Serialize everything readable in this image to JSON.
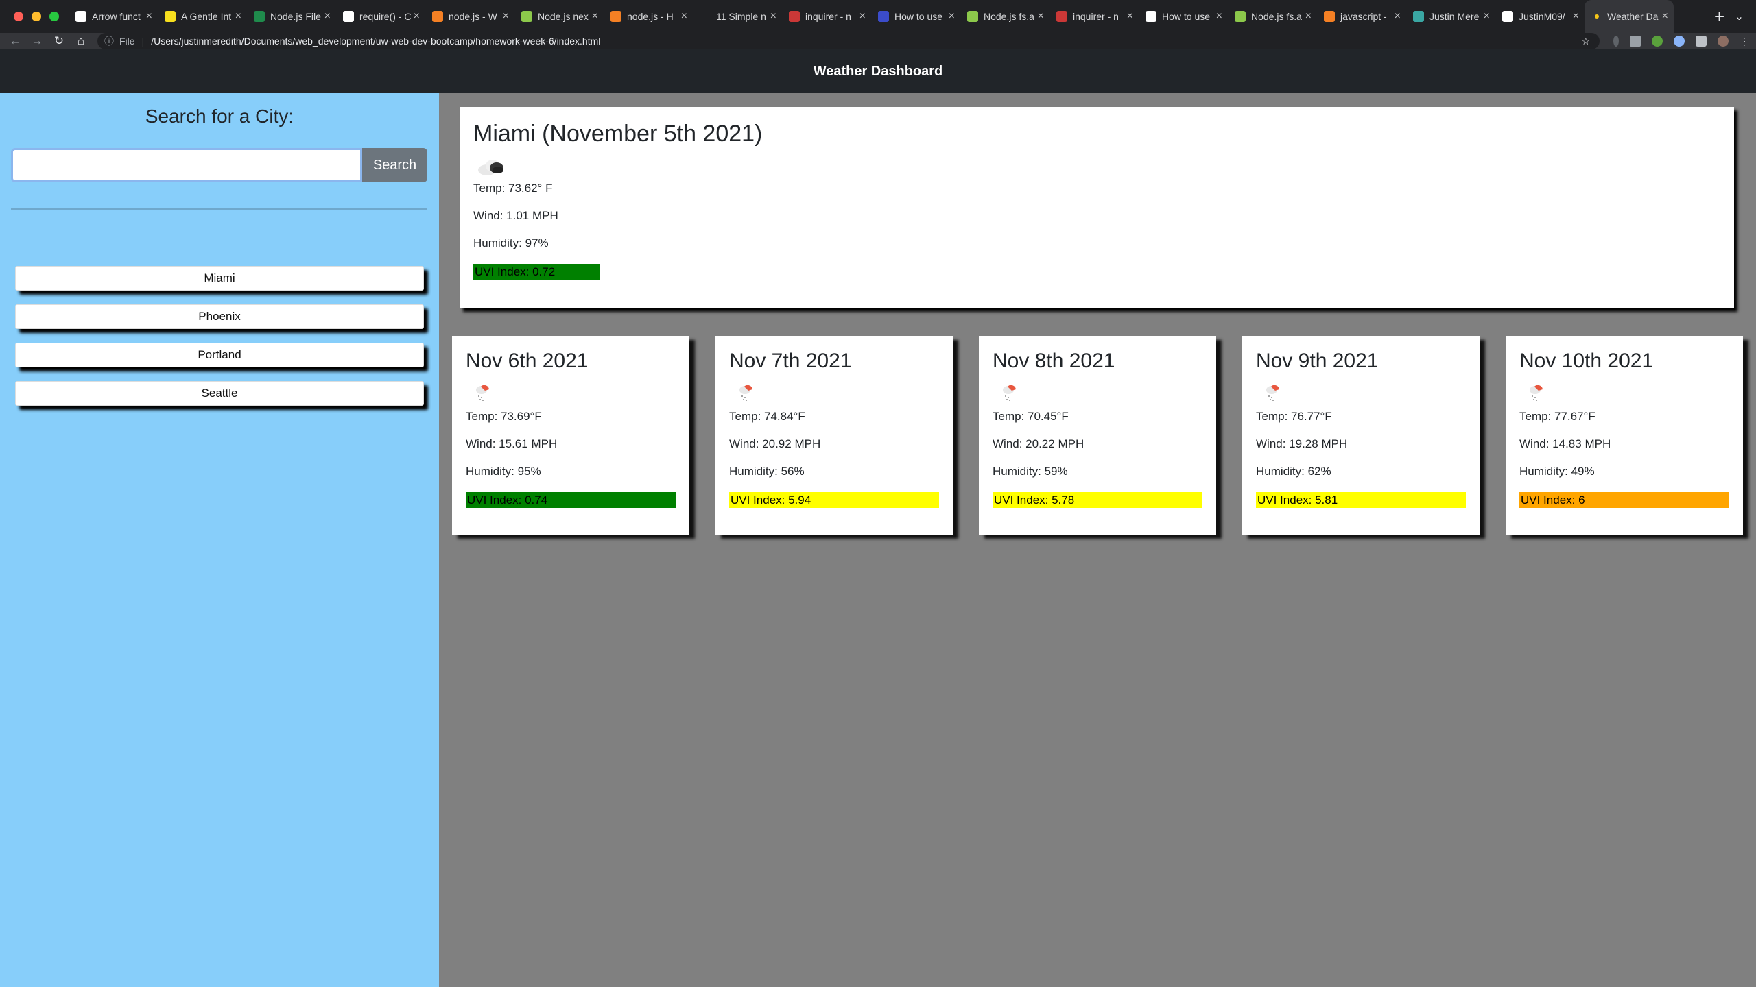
{
  "browser": {
    "tabs": [
      {
        "title": "Arrow funct",
        "favicon": "arrow-icon",
        "color": "#ffffff"
      },
      {
        "title": "A Gentle Int",
        "favicon": "js-icon",
        "color": "#f7df1e"
      },
      {
        "title": "Node.js File",
        "favicon": "w-icon",
        "color": "#1f8b4c"
      },
      {
        "title": "require() - C",
        "favicon": "google-icon",
        "color": "#ffffff"
      },
      {
        "title": "node.js - W",
        "favicon": "stackoverflow-icon",
        "color": "#f48024"
      },
      {
        "title": "Node.js nex",
        "favicon": "node-icon",
        "color": "#8cc84b"
      },
      {
        "title": "node.js - H",
        "favicon": "stackoverflow-icon",
        "color": "#f48024"
      },
      {
        "title": "11 Simple n",
        "favicon": "blank-icon",
        "color": "#202124"
      },
      {
        "title": "inquirer - n",
        "favicon": "npm-icon",
        "color": "#cb3837"
      },
      {
        "title": "How to use",
        "favicon": "js-icon",
        "color": "#3b4cca"
      },
      {
        "title": "Node.js fs.a",
        "favicon": "node-icon",
        "color": "#8cc84b"
      },
      {
        "title": "inquirer - n",
        "favicon": "npm-icon",
        "color": "#cb3837"
      },
      {
        "title": "How to use",
        "favicon": "page-icon",
        "color": "#ffffff"
      },
      {
        "title": "Node.js fs.a",
        "favicon": "node-icon",
        "color": "#8cc84b"
      },
      {
        "title": "javascript -",
        "favicon": "stackoverflow-icon",
        "color": "#f48024"
      },
      {
        "title": "Justin Mere",
        "favicon": "profile-icon",
        "color": "#3aa7a3"
      },
      {
        "title": "JustinM09/",
        "favicon": "github-icon",
        "color": "#ffffff"
      },
      {
        "title": "Weather Da",
        "favicon": "dot-icon",
        "color": "#f5c518",
        "active": true
      }
    ],
    "url_scheme": "File",
    "url": "/Users/justinmeredith/Documents/web_development/uw-web-dev-bootcamp/homework-week-6/index.html"
  },
  "header": {
    "title": "Weather Dashboard"
  },
  "sidebar": {
    "heading": "Search for a City:",
    "search_value": "",
    "search_button": "Search",
    "history": [
      "Miami",
      "Phoenix",
      "Portland",
      "Seattle"
    ]
  },
  "current": {
    "title": "Miami (November 5th 2021)",
    "icon": "cloud-icon",
    "temp": "Temp: 73.62° F",
    "wind": "Wind: 1.01 MPH",
    "humidity": "Humidity: 97%",
    "uvi": "UVI Index: 0.72",
    "uvi_color": "#008000"
  },
  "forecast": [
    {
      "date": "Nov 6th 2021",
      "icon": "rain-icon",
      "temp": "Temp: 73.69°F",
      "wind": "Wind: 15.61 MPH",
      "humidity": "Humidity: 95%",
      "uvi": "UVI Index: 0.74",
      "uvi_color": "#008000"
    },
    {
      "date": "Nov 7th 2021",
      "icon": "rain-icon",
      "temp": "Temp: 74.84°F",
      "wind": "Wind: 20.92 MPH",
      "humidity": "Humidity: 56%",
      "uvi": "UVI Index: 5.94",
      "uvi_color": "#ffff00"
    },
    {
      "date": "Nov 8th 2021",
      "icon": "rain-icon",
      "temp": "Temp: 70.45°F",
      "wind": "Wind: 20.22 MPH",
      "humidity": "Humidity: 59%",
      "uvi": "UVI Index: 5.78",
      "uvi_color": "#ffff00"
    },
    {
      "date": "Nov 9th 2021",
      "icon": "rain-icon",
      "temp": "Temp: 76.77°F",
      "wind": "Wind: 19.28 MPH",
      "humidity": "Humidity: 62%",
      "uvi": "UVI Index: 5.81",
      "uvi_color": "#ffff00"
    },
    {
      "date": "Nov 10th 2021",
      "icon": "rain-icon",
      "temp": "Temp: 77.67°F",
      "wind": "Wind: 14.83 MPH",
      "humidity": "Humidity: 49%",
      "uvi": "UVI Index: 6",
      "uvi_color": "#ffa500"
    }
  ]
}
